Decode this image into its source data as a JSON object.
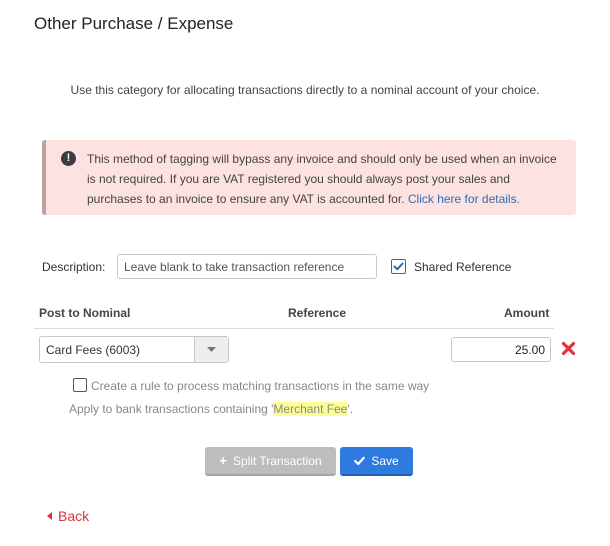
{
  "page": {
    "title": "Other Purchase / Expense",
    "intro": "Use this category for allocating transactions directly to a nominal account of your choice."
  },
  "alert": {
    "icon": "exclamation-circle-icon",
    "text": "This method of tagging will bypass any invoice and should only be used when an invoice is not required. If you are VAT registered you should always post your sales and purchases to an invoice to ensure any VAT is accounted for.",
    "link": "Click here for details."
  },
  "description": {
    "label": "Description:",
    "placeholder": "Leave blank to take transaction reference",
    "value": ""
  },
  "shared_reference": {
    "label": "Shared Reference",
    "checked": true
  },
  "table": {
    "headers": {
      "nominal": "Post to Nominal",
      "reference": "Reference",
      "amount": "Amount"
    },
    "rows": [
      {
        "nominal": "Card Fees (6003)",
        "reference": "",
        "amount": "25.00"
      }
    ]
  },
  "rule": {
    "label": "Create a rule to process matching transactions in the same way",
    "checked": false,
    "apply_prefix": "Apply to bank transactions containing '",
    "apply_term": "Merchant Fee",
    "apply_suffix": "'."
  },
  "buttons": {
    "split": "Split Transaction",
    "save": "Save",
    "back": "Back"
  },
  "colors": {
    "alert_bg": "#fde2e2",
    "primary": "#2e7ae0",
    "danger": "#d9363e",
    "disabled": "#bdbdbd",
    "highlight": "#fdfd96"
  }
}
